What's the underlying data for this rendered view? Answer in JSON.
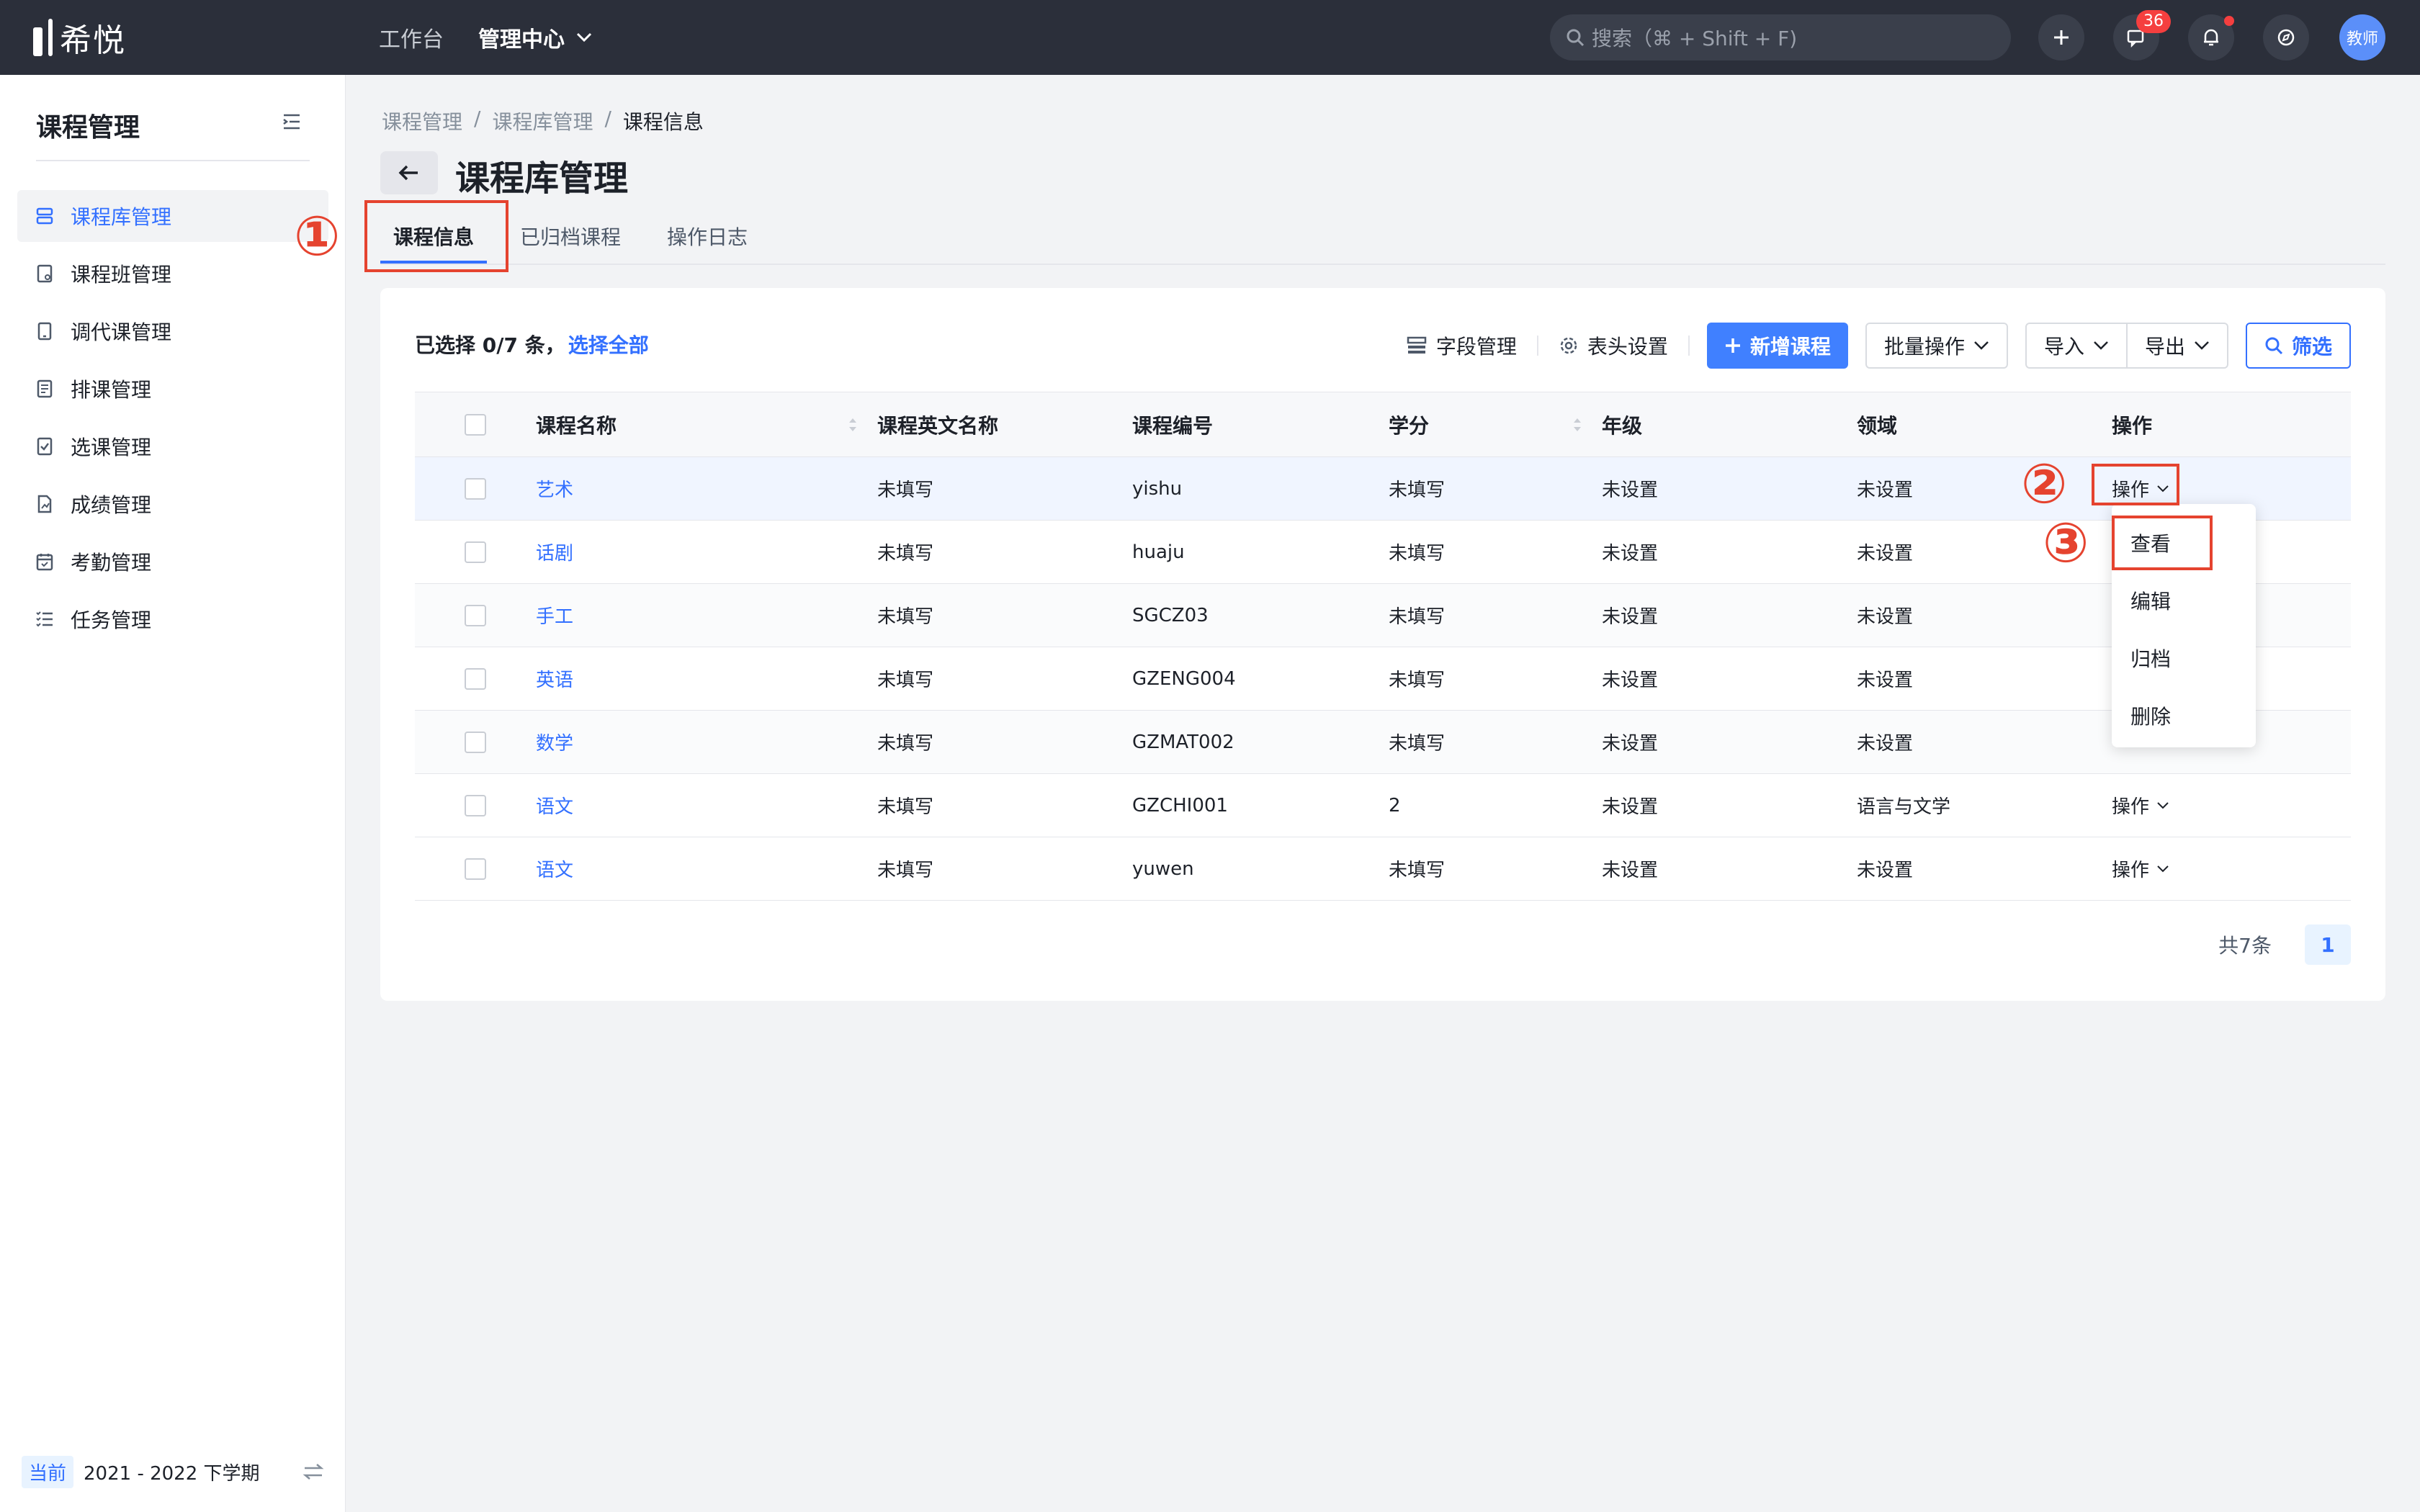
{
  "app": {
    "logo_text": "希悦",
    "top_nav": [
      "工作台",
      "管理中心"
    ],
    "search_placeholder": "搜索（⌘ + Shift + F)",
    "message_badge": "36",
    "avatar_label": "教师"
  },
  "sidebar": {
    "title": "课程管理",
    "items": [
      "课程库管理",
      "课程班管理",
      "调代课管理",
      "排课管理",
      "选课管理",
      "成绩管理",
      "考勤管理",
      "任务管理"
    ],
    "active_index": 0,
    "semester_tag": "当前",
    "semester_value": "2021 - 2022 下学期"
  },
  "breadcrumb": [
    "课程管理",
    "课程库管理",
    "课程信息"
  ],
  "page_title": "课程库管理",
  "tabs": [
    "课程信息",
    "已归档课程",
    "操作日志"
  ],
  "annotations": [
    "①",
    "②",
    "③"
  ],
  "selection": {
    "text": "已选择 0/7 条，",
    "select_all": "选择全部"
  },
  "toolbar": {
    "field_mgmt": "字段管理",
    "header_settings": "表头设置",
    "new_course": "新增课程",
    "batch_ops": "批量操作",
    "import": "导入",
    "export": "导出",
    "filter": "筛选"
  },
  "table": {
    "headers": [
      "课程名称",
      "课程英文名称",
      "课程编号",
      "学分",
      "年级",
      "领域",
      "操作"
    ],
    "rows": [
      {
        "name": "艺术",
        "en": "未填写",
        "code": "yishu",
        "credit": "未填写",
        "grade": "未设置",
        "field": "未设置",
        "op": "操作"
      },
      {
        "name": "话剧",
        "en": "未填写",
        "code": "huaju",
        "credit": "未填写",
        "grade": "未设置",
        "field": "未设置",
        "op": ""
      },
      {
        "name": "手工",
        "en": "未填写",
        "code": "SGCZ03",
        "credit": "未填写",
        "grade": "未设置",
        "field": "未设置",
        "op": ""
      },
      {
        "name": "英语",
        "en": "未填写",
        "code": "GZENG004",
        "credit": "未填写",
        "grade": "未设置",
        "field": "未设置",
        "op": ""
      },
      {
        "name": "数学",
        "en": "未填写",
        "code": "GZMAT002",
        "credit": "未填写",
        "grade": "未设置",
        "field": "未设置",
        "op": ""
      },
      {
        "name": "语文",
        "en": "未填写",
        "code": "GZCHI001",
        "credit": "2",
        "grade": "未设置",
        "field": "语言与文学",
        "op": "操作"
      },
      {
        "name": "语文",
        "en": "未填写",
        "code": "yuwen",
        "credit": "未填写",
        "grade": "未设置",
        "field": "未设置",
        "op": "操作"
      }
    ]
  },
  "dropdown": [
    "查看",
    "编辑",
    "归档",
    "删除"
  ],
  "pagination": {
    "total": "共7条",
    "current": "1"
  },
  "colors": {
    "accent": "#3370ff",
    "annotation": "#e5432f",
    "topbar": "#2b2f3a"
  }
}
